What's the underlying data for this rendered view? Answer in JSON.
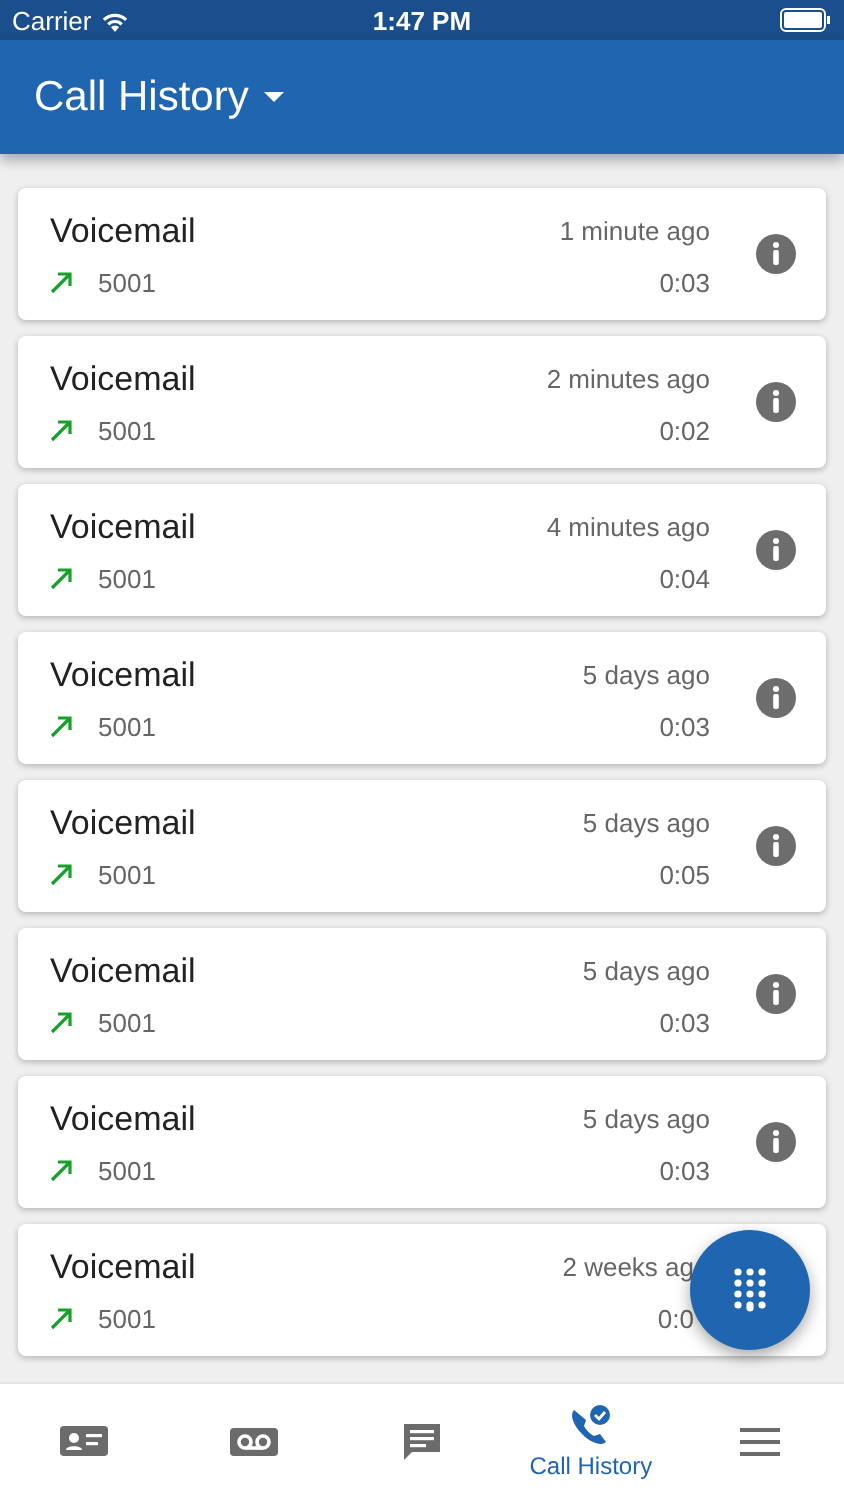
{
  "status_bar": {
    "carrier": "Carrier",
    "time": "1:47 PM"
  },
  "app_bar": {
    "title": "Call History"
  },
  "calls": [
    {
      "name": "Voicemail",
      "number": "5001",
      "time": "1 minute ago",
      "duration": "0:03"
    },
    {
      "name": "Voicemail",
      "number": "5001",
      "time": "2 minutes ago",
      "duration": "0:02"
    },
    {
      "name": "Voicemail",
      "number": "5001",
      "time": "4 minutes ago",
      "duration": "0:04"
    },
    {
      "name": "Voicemail",
      "number": "5001",
      "time": "5 days ago",
      "duration": "0:03"
    },
    {
      "name": "Voicemail",
      "number": "5001",
      "time": "5 days ago",
      "duration": "0:05"
    },
    {
      "name": "Voicemail",
      "number": "5001",
      "time": "5 days ago",
      "duration": "0:03"
    },
    {
      "name": "Voicemail",
      "number": "5001",
      "time": "5 days ago",
      "duration": "0:03"
    },
    {
      "name": "Voicemail",
      "number": "5001",
      "time": "2 weeks ag",
      "duration": "0:0",
      "covered": true
    }
  ],
  "tabs": [
    {
      "kind": "contacts",
      "selected": false
    },
    {
      "kind": "voicemail",
      "selected": false
    },
    {
      "kind": "messages",
      "selected": false
    },
    {
      "kind": "history",
      "label": "Call History",
      "selected": true
    },
    {
      "kind": "menu",
      "selected": false
    }
  ]
}
